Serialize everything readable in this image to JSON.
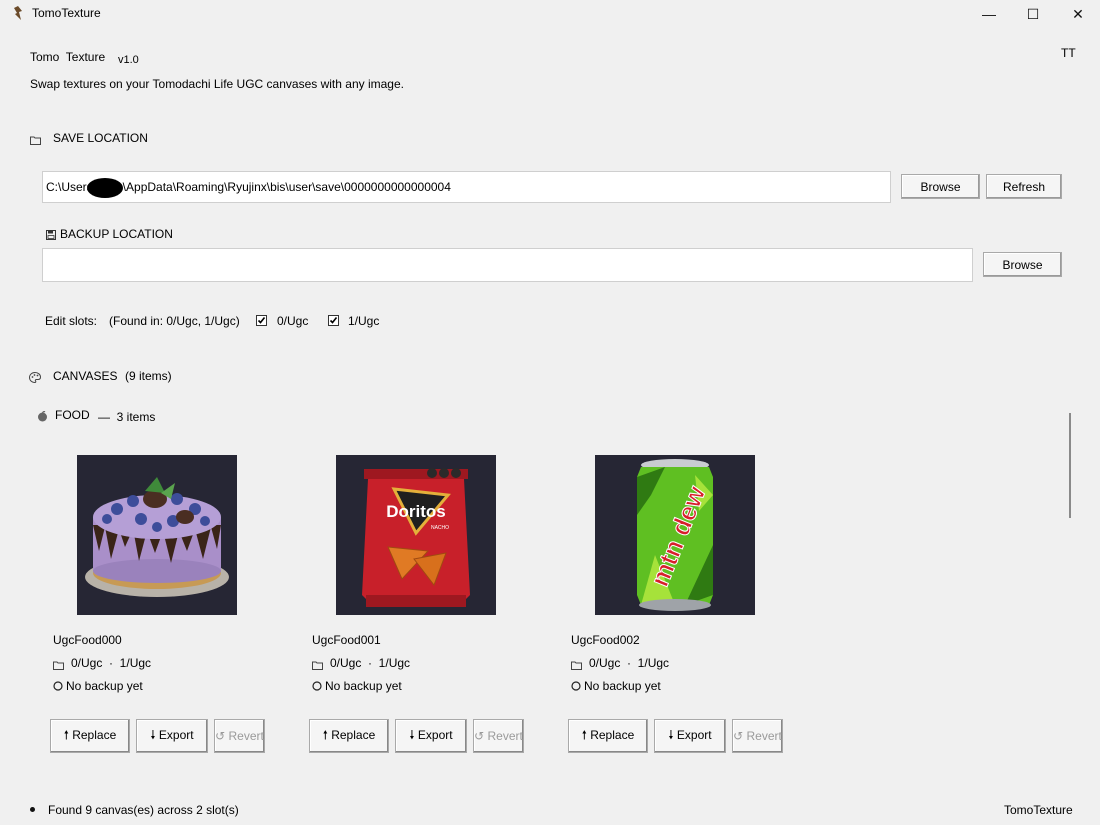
{
  "window": {
    "title": "TomoTexture",
    "minimize_glyph": "—",
    "maximize_glyph": "☐",
    "close_glyph": "✕"
  },
  "header": {
    "app_name": "Tomo  Texture",
    "version": "v1.0",
    "subtitle": "Swap textures on your Tomodachi Life UGC canvases with any image.",
    "corner_label": "TT"
  },
  "save_location": {
    "heading": "SAVE LOCATION",
    "icon": "folder-icon",
    "path": "C:\\Users\\        \\AppData\\Roaming\\Ryujinx\\bis\\user\\save\\0000000000000004",
    "browse_label": "Browse",
    "refresh_label": "Refresh"
  },
  "backup_location": {
    "heading": "BACKUP LOCATION",
    "icon": "floppy-disk-icon",
    "path": "",
    "browse_label": "Browse"
  },
  "slots": {
    "label": "Edit slots:",
    "found_text": "(Found in: 0/Ugc, 1/Ugc)",
    "options": [
      {
        "label": "0/Ugc",
        "checked": true
      },
      {
        "label": "1/Ugc",
        "checked": true
      }
    ]
  },
  "canvases": {
    "heading": "CANVASES",
    "count_text": "(9 items)",
    "icon": "palette-icon",
    "category": {
      "name": "FOOD",
      "count_text": "—  3 items",
      "icon": "food-icon",
      "cards": [
        {
          "name": "UgcFood000",
          "image": "blueberry-cake-image",
          "slots_text": "0/Ugc  ·  1/Ugc",
          "backup_text": "No backup yet",
          "replace_label": "🠕 Replace",
          "export_label": "🠗 Export",
          "revert_label": "↺ Revert"
        },
        {
          "name": "UgcFood001",
          "image": "doritos-bag-image",
          "image_text": "Doritos",
          "image_subtext": "NACHO",
          "slots_text": "0/Ugc  ·  1/Ugc",
          "backup_text": "No backup yet",
          "replace_label": "🠕 Replace",
          "export_label": "🠗 Export",
          "revert_label": "↺ Revert"
        },
        {
          "name": "UgcFood002",
          "image": "mtn-dew-can-image",
          "image_text": "mtn dew",
          "slots_text": "0/Ugc  ·  1/Ugc",
          "backup_text": "No backup yet",
          "replace_label": "🠕 Replace",
          "export_label": "🠗 Export",
          "revert_label": "↺ Revert"
        }
      ]
    }
  },
  "status_bar": {
    "message": "Found 9 canvas(es) across 2 slot(s)",
    "app_label": "TomoTexture"
  },
  "colors": {
    "window_bg": "#f0f0f0",
    "input_bg": "#ffffff",
    "image_bg": "#2a2a38"
  }
}
